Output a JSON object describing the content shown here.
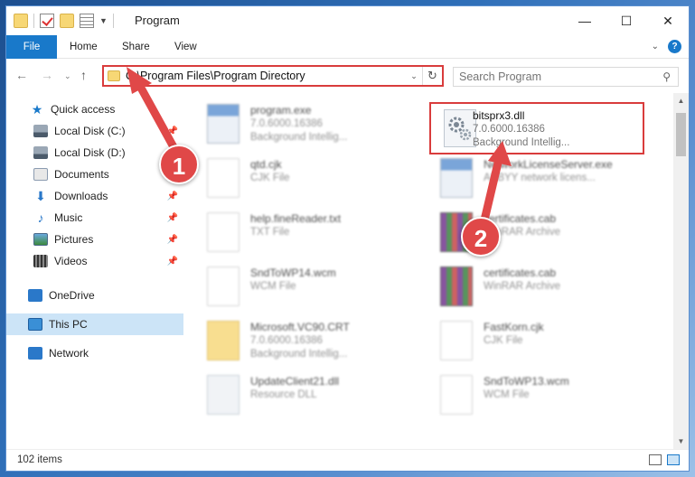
{
  "window": {
    "title": "Program"
  },
  "ribbon": {
    "tabs": [
      "File",
      "Home",
      "Share",
      "View"
    ]
  },
  "address": {
    "path": "C:\\Program Files\\Program Directory"
  },
  "search": {
    "placeholder": "Search Program"
  },
  "sidebar": {
    "items": [
      {
        "label": "Quick access",
        "icon": "star-icon"
      },
      {
        "label": "Local Disk (C:)",
        "icon": "disk-icon",
        "pinned": true
      },
      {
        "label": "Local Disk (D:)",
        "icon": "disk-icon"
      },
      {
        "label": "Documents",
        "icon": "documents-icon"
      },
      {
        "label": "Downloads",
        "icon": "downloads-icon",
        "pinned": true
      },
      {
        "label": "Music",
        "icon": "music-icon",
        "pinned": true
      },
      {
        "label": "Pictures",
        "icon": "pictures-icon",
        "pinned": true
      },
      {
        "label": "Videos",
        "icon": "videos-icon",
        "pinned": true
      },
      {
        "label": "OneDrive",
        "icon": "onedrive-icon"
      },
      {
        "label": "This PC",
        "icon": "pc-icon",
        "selected": true
      },
      {
        "label": "Network",
        "icon": "network-icon"
      }
    ]
  },
  "files": {
    "left": [
      {
        "name": "program.exe",
        "line1": "7.0.6000.16386",
        "line2": "Background Intellig..."
      },
      {
        "name": "qtd.cjk",
        "line1": "CJK File",
        "line2": ""
      },
      {
        "name": "help.fineReader.txt",
        "line1": "TXT File",
        "line2": ""
      },
      {
        "name": "SndToWP14.wcm",
        "line1": "WCM File",
        "line2": ""
      },
      {
        "name": "Microsoft.VC90.CRT",
        "line1": "7.0.6000.16386",
        "line2": "Background Intellig..."
      },
      {
        "name": "UpdateClient21.dll",
        "line1": "Resource DLL",
        "line2": ""
      }
    ],
    "right": [
      {
        "name": "bitsprx3.dll",
        "line1": "7.0.6000.16386",
        "line2": "Background Intellig..."
      },
      {
        "name": "NetworkLicenseServer.exe",
        "line1": "ABBYY network licens...",
        "line2": ""
      },
      {
        "name": "certificates.cab",
        "line1": "WinRAR Archive",
        "line2": ""
      },
      {
        "name": "certificates.cab",
        "line1": "WinRAR Archive",
        "line2": ""
      },
      {
        "name": "FastKorn.cjk",
        "line1": "CJK File",
        "line2": ""
      },
      {
        "name": "SndToWP13.wcm",
        "line1": "WCM File",
        "line2": ""
      }
    ]
  },
  "status": {
    "count": "102 items"
  },
  "annotations": {
    "step1": "1",
    "step2": "2"
  },
  "colors": {
    "accent": "#1979ca",
    "highlight": "#d93c3c"
  }
}
